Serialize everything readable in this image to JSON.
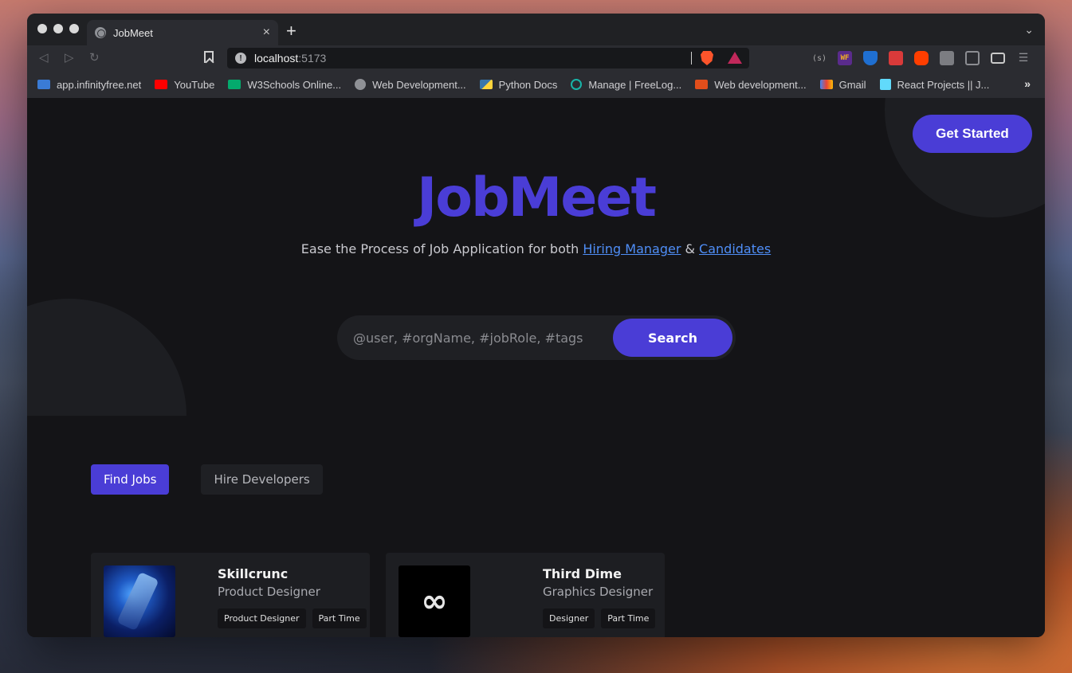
{
  "browser": {
    "tab_title": "JobMeet",
    "tab_close": "×",
    "new_tab": "+",
    "tab_list": "⌄",
    "url_host": "localhost",
    "url_port": ":5173",
    "nav_back": "◁",
    "nav_forward": "▷",
    "nav_reload": "↻",
    "more_bookmarks": "»",
    "bookmarks": [
      {
        "label": "app.infinityfree.net",
        "color": "#3a7bd5"
      },
      {
        "label": "YouTube",
        "color": "#ff0000"
      },
      {
        "label": "W3Schools Online...",
        "color": "#04aa6d"
      },
      {
        "label": "Web Development...",
        "color": "#8f9196"
      },
      {
        "label": "Python Docs",
        "color": "#3776ab"
      },
      {
        "label": "Manage | FreeLog...",
        "color": "#18b4a8"
      },
      {
        "label": "Web development...",
        "color": "#e24e1b"
      },
      {
        "label": "Gmail",
        "color": "#ea4335"
      },
      {
        "label": "React Projects || J...",
        "color": "#61dafb"
      }
    ],
    "extensions": {
      "s": "(s)",
      "wf": "WF",
      "menu": "☰"
    }
  },
  "page": {
    "get_started": "Get Started",
    "brand": "JobMeet",
    "tagline_prefix": "Ease the Process of Job Application for both ",
    "tagline_link1": "Hiring Manager",
    "tagline_amp": " & ",
    "tagline_link2": "Candidates",
    "search_placeholder": "@user, #orgName, #jobRole, #tags",
    "search_button": "Search",
    "tabs": [
      "Find Jobs",
      "Hire Developers"
    ],
    "jobs": [
      {
        "company": "Skillcrunc",
        "role": "Product Designer",
        "tags": [
          "Product Designer",
          "Part Time"
        ]
      },
      {
        "company": "Third Dime",
        "role": "Graphics Designer",
        "tags": [
          "Designer",
          "Part Time"
        ]
      }
    ],
    "accent_color": "#4a3dd6",
    "link_color": "#4f8ef7"
  }
}
